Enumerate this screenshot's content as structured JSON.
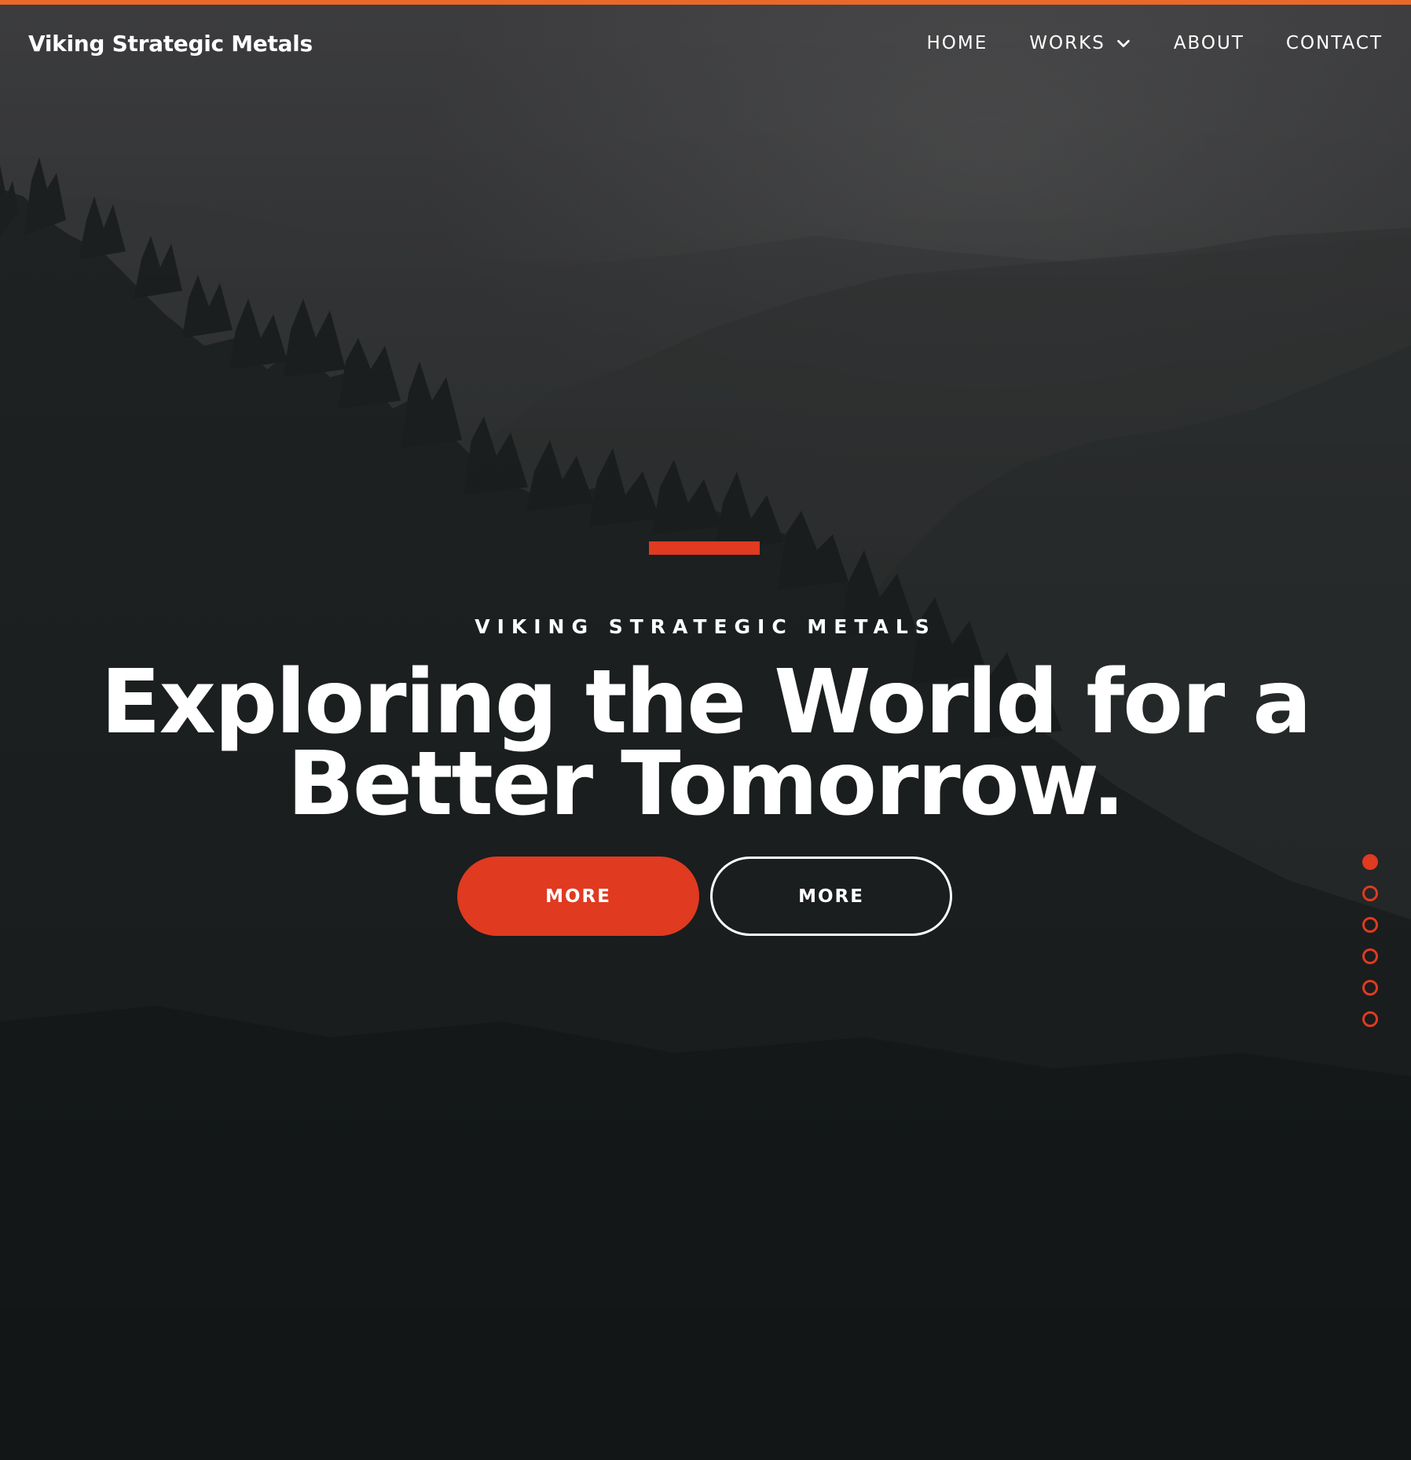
{
  "header": {
    "brand": "Viking Strategic Metals",
    "nav": [
      {
        "label": "HOME"
      },
      {
        "label": "WORKS",
        "icon": "chevron-down-icon"
      },
      {
        "label": "ABOUT"
      },
      {
        "label": "CONTACT"
      }
    ]
  },
  "hero": {
    "eyebrow": "VIKING STRATEGIC METALS",
    "headline_line1": "Exploring the World for a",
    "headline_line2": "Better Tomorrow.",
    "primary_button": "MORE",
    "secondary_button": "MORE"
  },
  "slider": {
    "total_slides": 6,
    "active_slide": 1
  },
  "colors": {
    "accent": "#e03a21",
    "top_bar": "#e8692b",
    "text": "#ffffff",
    "background_dark": "#1b1f1f"
  }
}
